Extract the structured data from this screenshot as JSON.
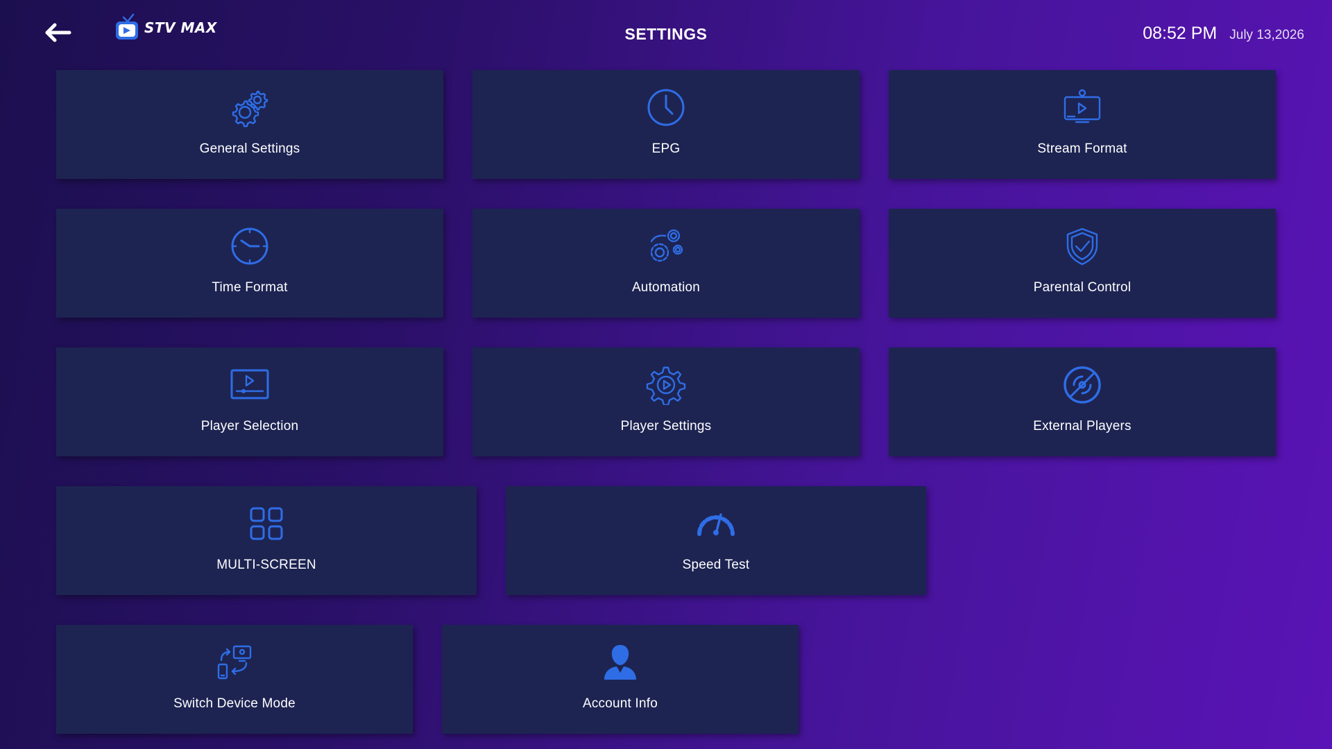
{
  "header": {
    "back_icon": "arrow-left-icon",
    "logo_text": "STV MAX",
    "title": "SETTINGS",
    "time": "08:52 PM",
    "date": "July 13,2026"
  },
  "tiles": [
    {
      "label": "General Settings",
      "icon": "gears-icon"
    },
    {
      "label": "EPG",
      "icon": "clock-icon"
    },
    {
      "label": "Stream Format",
      "icon": "monitor-play-icon"
    },
    {
      "label": "Time Format",
      "icon": "clock-face-icon"
    },
    {
      "label": "Automation",
      "icon": "automation-gears-icon"
    },
    {
      "label": "Parental Control",
      "icon": "shield-check-icon"
    },
    {
      "label": "Player Selection",
      "icon": "player-screen-icon"
    },
    {
      "label": "Player Settings",
      "icon": "gear-play-icon"
    },
    {
      "label": "External Players",
      "icon": "radar-icon"
    },
    {
      "label": "MULTI-SCREEN",
      "icon": "grid-icon"
    },
    {
      "label": "Speed Test",
      "icon": "speedometer-icon"
    },
    {
      "label": "Switch Device Mode",
      "icon": "devices-switch-icon"
    },
    {
      "label": "Account Info",
      "icon": "user-icon"
    }
  ],
  "colors": {
    "accent": "#2f6de6",
    "tile_bg": "#1d2452",
    "bg_start": "#1c0f4f",
    "bg_end": "#5a13b6"
  }
}
